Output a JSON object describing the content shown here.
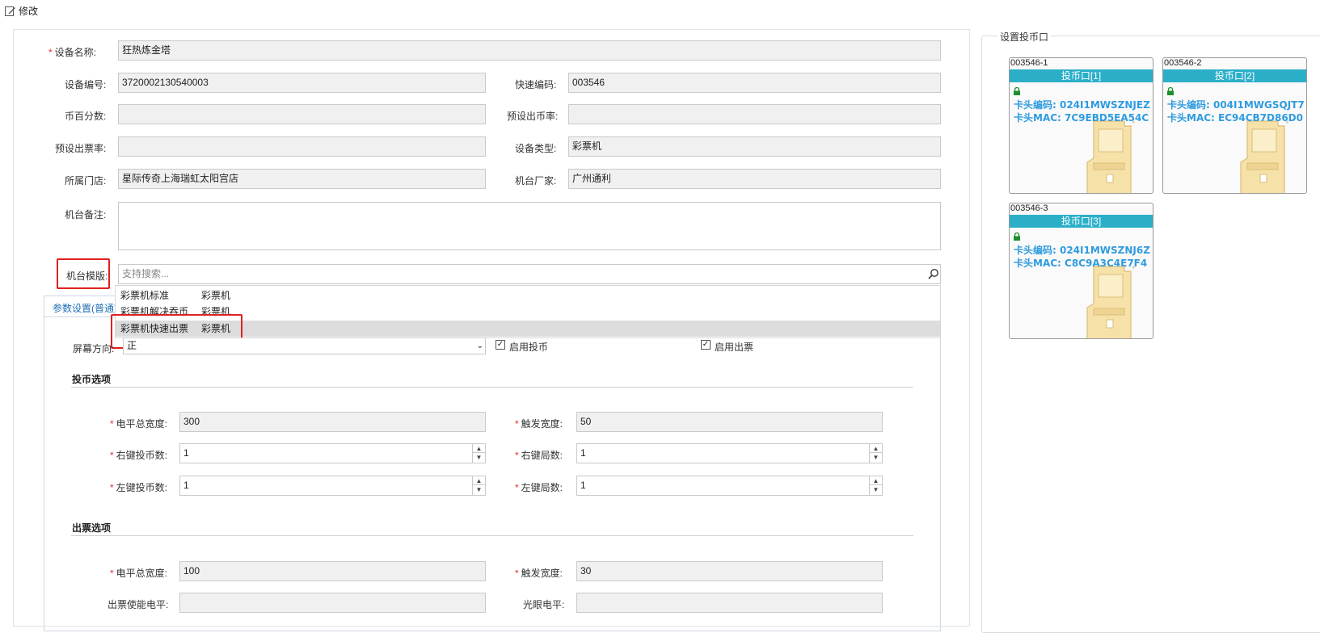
{
  "window": {
    "title": "修改"
  },
  "form": {
    "device_name": {
      "label": "设备名称:",
      "value": "狂热炼金塔"
    },
    "device_code": {
      "label": "设备编号:",
      "value": "3720002130540003"
    },
    "quick_code": {
      "label": "快速编码:",
      "value": "003546"
    },
    "coin_percent": {
      "label": "币百分数:",
      "value": ""
    },
    "preset_coin_rate": {
      "label": "预设出币率:",
      "value": ""
    },
    "preset_ticket_rate": {
      "label": "预设出票率:",
      "value": ""
    },
    "device_type": {
      "label": "设备类型:",
      "value": "彩票机"
    },
    "store": {
      "label": "所属门店:",
      "value": "星际传奇上海瑞虹太阳宫店"
    },
    "manufacturer": {
      "label": "机台厂家:",
      "value": "广州通利"
    },
    "remark": {
      "label": "机台备注:",
      "value": ""
    },
    "template": {
      "label": "机台模版:",
      "placeholder": "支持搜索..."
    }
  },
  "dropdown": {
    "items": [
      {
        "name": "彩票机标准",
        "type": "彩票机"
      },
      {
        "name": "彩票机解决吞币",
        "type": "彩票机"
      },
      {
        "name": "彩票机快速出票",
        "type": "彩票机"
      }
    ]
  },
  "tab": {
    "label": "参数设置(普通)"
  },
  "params": {
    "screen_direction": {
      "label": "屏幕方向:",
      "value": "正"
    },
    "enable_coin": "启用投币",
    "enable_ticket": "启用出票"
  },
  "coin_options": {
    "title": "投币选项",
    "level_width": {
      "label": "电平总宽度:",
      "value": "300"
    },
    "trigger_width": {
      "label": "触发宽度:",
      "value": "50"
    },
    "right_coin": {
      "label": "右键投币数:",
      "value": "1"
    },
    "right_rounds": {
      "label": "右键局数:",
      "value": "1"
    },
    "left_coin": {
      "label": "左键投币数:",
      "value": "1"
    },
    "left_rounds": {
      "label": "左键局数:",
      "value": "1"
    }
  },
  "ticket_options": {
    "title": "出票选项",
    "level_width": {
      "label": "电平总宽度:",
      "value": "100"
    },
    "trigger_width": {
      "label": "触发宽度:",
      "value": "30"
    },
    "enable_level": {
      "label": "出票使能电平:",
      "value": ""
    },
    "eye_level": {
      "label": "光眼电平:",
      "value": ""
    }
  },
  "coin_slots": {
    "legend": "设置投币口",
    "cards": [
      {
        "id": "003546-1",
        "title": "投币口[1]",
        "code": "卡头编码: 024I1MWSZNJEZ",
        "mac": "卡头MAC: 7C9EBD5EA54C"
      },
      {
        "id": "003546-2",
        "title": "投币口[2]",
        "code": "卡头编码: 004I1MWGSQJT7",
        "mac": "卡头MAC: EC94CB7D86D0"
      },
      {
        "id": "003546-3",
        "title": "投币口[3]",
        "code": "卡头编码: 024I1MWSZNJ6Z",
        "mac": "卡头MAC: C8C9A3C4E7F4"
      }
    ]
  },
  "colors": {
    "accent": "#2bafc9",
    "link": "#2f9be0",
    "highlight": "#e02020",
    "required": "#e0312f"
  }
}
